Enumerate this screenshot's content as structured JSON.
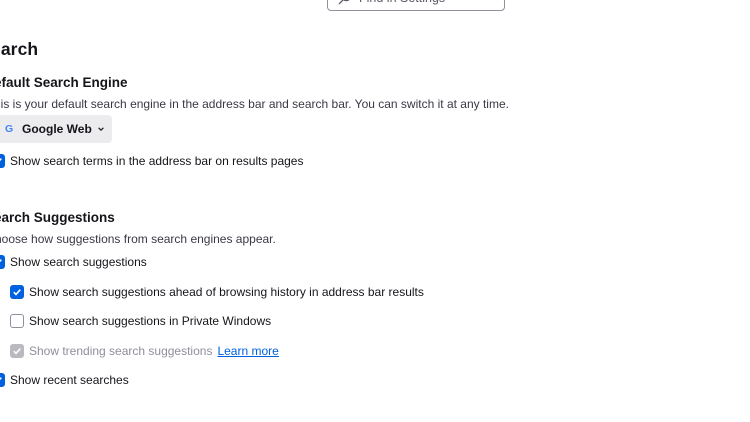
{
  "search_box": {
    "placeholder": "Find in Settings"
  },
  "section": {
    "title": "earch"
  },
  "default_engine": {
    "heading": "efault Search Engine",
    "description": "nis is your default search engine in the address bar and search bar. You can switch it at any time.",
    "selected_engine": "Google Web",
    "engine_icon": "G",
    "show_terms_label": "Show search terms in the address bar on results pages"
  },
  "suggestions": {
    "heading": "earch Suggestions",
    "description": "hoose how suggestions from search engines appear.",
    "items": [
      {
        "label": "Show search suggestions",
        "state": "checked"
      },
      {
        "label": "Show search suggestions ahead of browsing history in address bar results",
        "state": "checked"
      },
      {
        "label": "Show search suggestions in Private Windows",
        "state": "unchecked"
      },
      {
        "label": "Show trending search suggestions",
        "state": "disabled-checked",
        "link": "Learn more"
      },
      {
        "label": "Show recent searches",
        "state": "checked"
      }
    ]
  },
  "colors": {
    "accent": "#0061e0",
    "text": "#15141a",
    "disabled": "#8f8f9d"
  }
}
